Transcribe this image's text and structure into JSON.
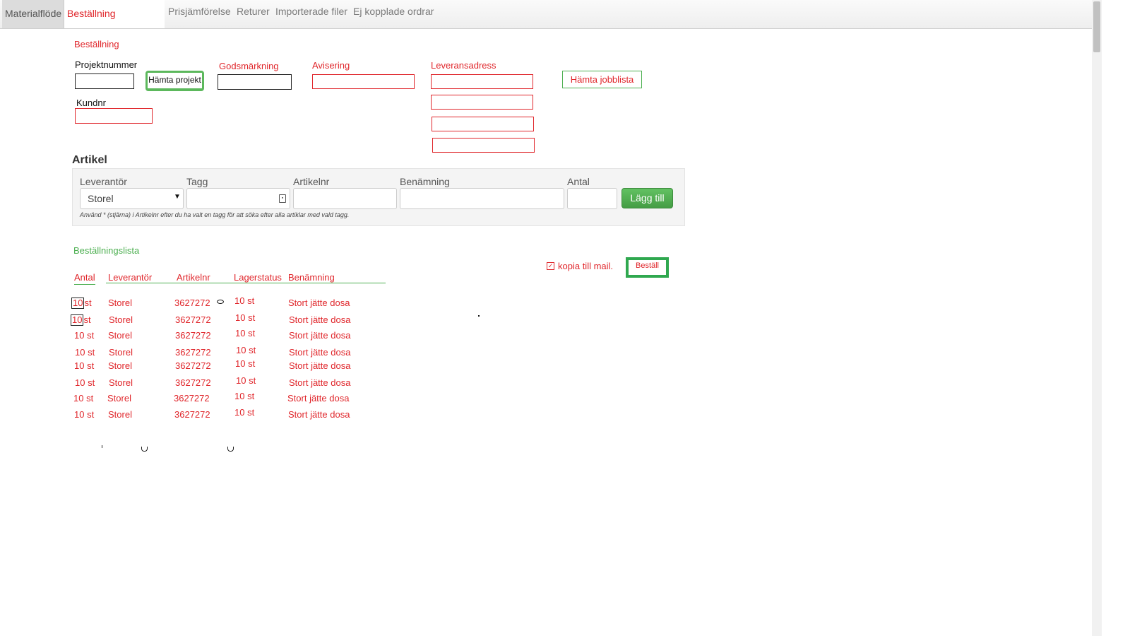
{
  "nav": {
    "tabs": [
      "Materialflöde",
      "Beställning"
    ],
    "links": [
      "Prisjämförelse",
      "Returer",
      "Importerade filer",
      "Ej kopplade ordrar"
    ]
  },
  "form": {
    "section_title": "Beställning",
    "project_number_label": "Projektnummer",
    "fetch_project_label": "Hämta projekt",
    "goods_marking_label": "Godsmärkning",
    "notice_label": "Avisering",
    "delivery_address_label": "Leveransadress",
    "fetch_joblist_label": "Hämta jobblista",
    "customer_number_label": "Kundnr"
  },
  "article": {
    "title": "Artikel",
    "supplier_label": "Leverantör",
    "supplier_value": "Storel",
    "tag_label": "Tagg",
    "article_no_label": "Artikelnr",
    "name_label": "Benämning",
    "quantity_label": "Antal",
    "add_label": "Lägg till",
    "hint": "Använd * (stjärna) i Artikelnr efter du ha valt en tagg för att söka efter alla artiklar med vald tagg."
  },
  "order_list": {
    "title": "Beställningslista",
    "copy_mail_label": "kopia till mail.",
    "order_button_label": "Beställ",
    "headers": [
      "Antal",
      "Leverantör",
      "Artikelnr",
      "Lagerstatus",
      "Benämning"
    ],
    "rows": [
      {
        "qty_num": "10",
        "qty_unit": "st",
        "supplier": "Storel",
        "article": "3627272",
        "stock": "10 st",
        "name": "Stort jätte dosa"
      },
      {
        "qty_num": "10",
        "qty_unit": "st",
        "supplier": "Storel",
        "article": "3627272",
        "stock": "10 st",
        "name": "Stort jätte dosa"
      },
      {
        "qty": "10 st",
        "supplier": "Storel",
        "article": "3627272",
        "stock": "10 st",
        "name": "Stort jätte dosa"
      },
      {
        "qty": "10 st",
        "supplier": "Storel",
        "article": "3627272",
        "stock": "10 st",
        "name": "Stort jätte dosa"
      },
      {
        "qty": "10 st",
        "supplier": "Storel",
        "article": "3627272",
        "stock": "10 st",
        "name": "Stort jätte dosa"
      },
      {
        "qty": "10 st",
        "supplier": "Storel",
        "article": "3627272",
        "stock": "10 st",
        "name": "Stort jätte dosa"
      },
      {
        "qty": "10 st",
        "supplier": "Storel",
        "article": "3627272",
        "stock": "10 st",
        "name": "Stort jätte dosa"
      },
      {
        "qty": "10 st",
        "supplier": "Storel",
        "article": "3627272",
        "stock": "10 st",
        "name": "Stort jätte dosa"
      }
    ]
  },
  "colors": {
    "accent_red": "#e0262b",
    "accent_green": "#4caf50",
    "button_green": "#5cb85c"
  }
}
